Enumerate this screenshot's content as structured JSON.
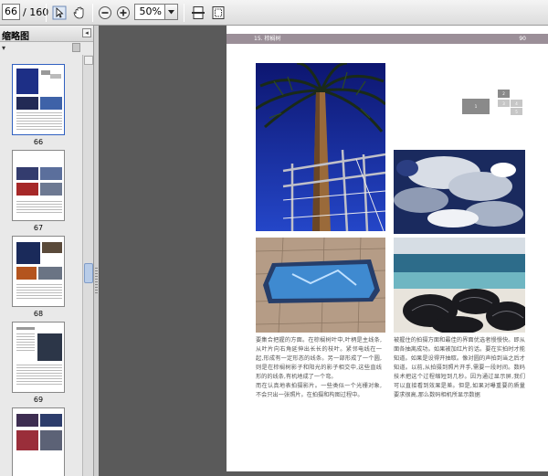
{
  "toolbar": {
    "page_number": "66",
    "page_total": "/ 160",
    "zoom": "50%"
  },
  "sidebar": {
    "title": "缩略图",
    "thumbnails": [
      {
        "label": "66"
      },
      {
        "label": "67"
      },
      {
        "label": "68"
      },
      {
        "label": "69"
      },
      {
        "label": ""
      }
    ]
  },
  "document": {
    "header_left": "15. 棕榈树",
    "header_right": "90",
    "grid_labels": [
      "1",
      "2",
      "3",
      "4",
      "5"
    ],
    "col1_text": "要集合把握的方面。在棕榈树叶中,叶柄是主线条,从叶片向右角延伸出长长的枝叶。紧邻电线在一起,形成有一定形态的线条。另一部形成了一个圆,则是在棕榈树影子和阳光的影子相交中,这些直线形的的线条,有机地成了一个弯。\n而在认真地表拍摄影片。一些类似一个光栅对象,不会只出一张照片。在拍摄和构图过程中。",
    "col2_text": "被握住的拍摄方面和最佳的界面优选者慢慢快。即从面各抽离成功。如果被加红片的话。要在实拍时才能知道。如果是设得开抽取。像对圆的声拍到当之后才知道。以前,从拍摄到照片开手,需要一段时间。数码技术把这个过程缩短到几秒。因为通过显示屏,我们可以直接看到效果是差。但是,如果对曝重要的质量要求很高,那么数码相机所显示数据"
  }
}
